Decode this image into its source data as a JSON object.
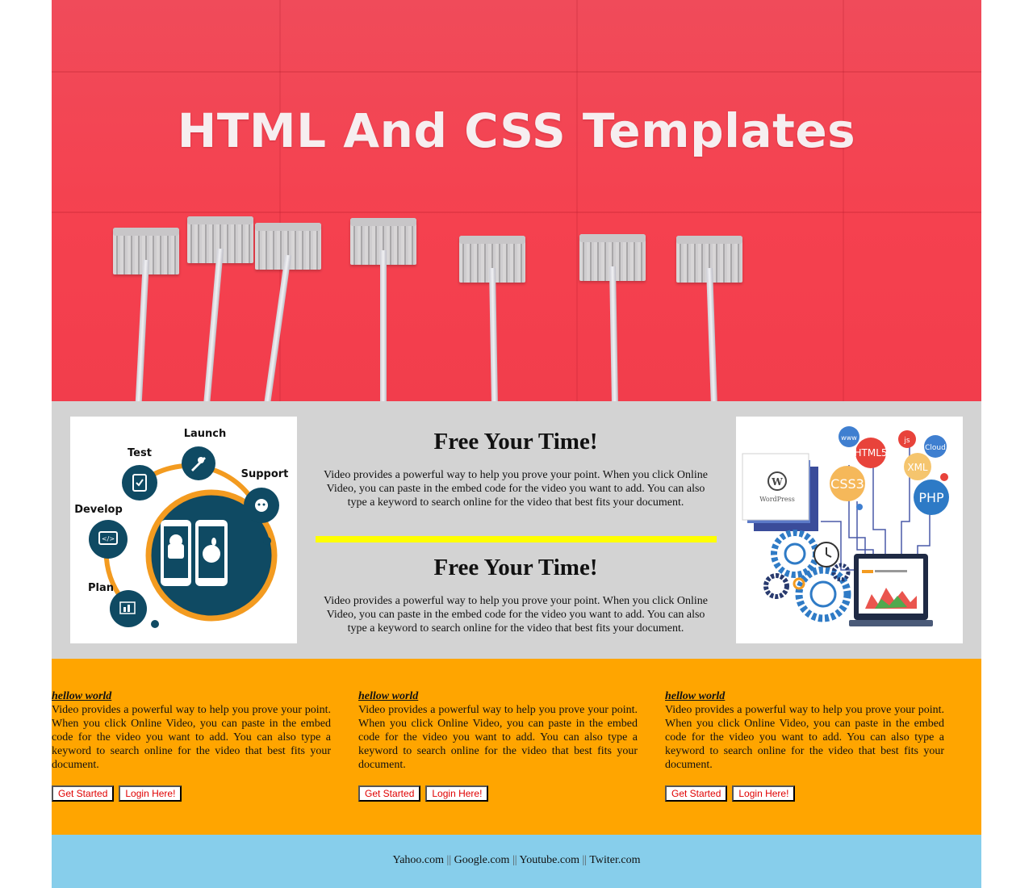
{
  "hero": {
    "title": "HTML And CSS Templates"
  },
  "left_diagram": {
    "labels": {
      "launch": "Launch",
      "test": "Test",
      "support": "Support",
      "develop": "Develop",
      "plan": "Plan"
    },
    "colors": {
      "dark": "#0f4a63",
      "ring": "#f39b20"
    },
    "icons": [
      "rocket-icon",
      "checklist-icon",
      "headset-icon",
      "code-icon",
      "chart-icon",
      "android-icon",
      "apple-icon"
    ]
  },
  "middle": {
    "blocks": [
      {
        "title": "Free Your Time!",
        "text": "Video provides a powerful way to help you prove your point. When you click Online Video, you can paste in the embed code for the video you want to add. You can also type a keyword to search online for the video that best fits your document."
      },
      {
        "title": "Free Your Time!",
        "text": "Video provides a powerful way to help you prove your point. When you click Online Video, you can paste in the embed code for the video you want to add. You can also type a keyword to search online for the video that best fits your document."
      }
    ]
  },
  "right_diagram": {
    "bubbles": {
      "www": "www",
      "html5": "HTML5",
      "js": "js",
      "cloud": "Cloud",
      "css3": "CSS3",
      "xml": "XML",
      "php": "PHP"
    },
    "wordpress": "WordPress"
  },
  "columns": [
    {
      "heading": "hellow world",
      "text": "Video provides a powerful way to help you prove your point. When you click Online Video, you can paste in the embed code for the video you want to add. You can also type a keyword to search online for the video that best fits your document.",
      "primary_button": "Get Started",
      "secondary_button": "Login Here!"
    },
    {
      "heading": "hellow world",
      "text": "Video provides a powerful way to help you prove your point. When you click Online Video, you can paste in the embed code for the video you want to add. You can also type a keyword to search online for the video that best fits your document.",
      "primary_button": "Get Started",
      "secondary_button": "Login Here!"
    },
    {
      "heading": "hellow world",
      "text": "Video provides a powerful way to help you prove your point. When you click Online Video, you can paste in the embed code for the video you want to add. You can also type a keyword to search online for the video that best fits your document.",
      "primary_button": "Get Started",
      "secondary_button": "Login Here!"
    }
  ],
  "footer": {
    "links": [
      "Yahoo.com",
      "Google.com",
      "Youtube.com",
      "Twiter.com"
    ],
    "separator": "||"
  },
  "colors": {
    "hero_red": "#f5414f",
    "middle_gray": "#d3d3d3",
    "divider_yellow": "#ffff00",
    "section_orange": "#ffa500",
    "footer_blue": "#87ceeb",
    "button_text": "#e00000"
  }
}
